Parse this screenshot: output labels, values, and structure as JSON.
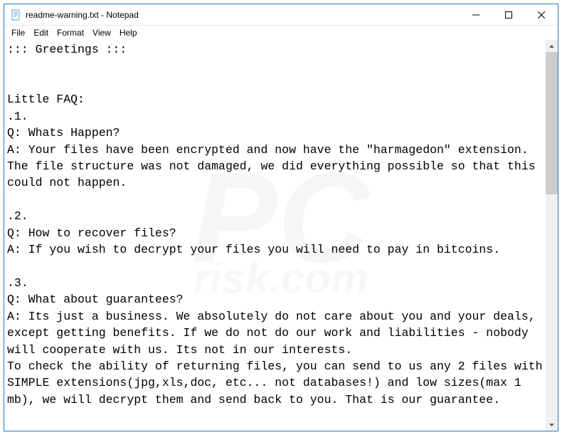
{
  "titlebar": {
    "title": "readme-warning.txt - Notepad"
  },
  "menubar": {
    "file": "File",
    "edit": "Edit",
    "format": "Format",
    "view": "View",
    "help": "Help"
  },
  "content": {
    "text": "::: Greetings :::\n\n\nLittle FAQ:\n.1.\nQ: Whats Happen?\nA: Your files have been encrypted and now have the \"harmagedon\" extension. The file structure was not damaged, we did everything possible so that this could not happen.\n\n.2.\nQ: How to recover files?\nA: If you wish to decrypt your files you will need to pay in bitcoins.\n\n.3.\nQ: What about guarantees?\nA: Its just a business. We absolutely do not care about you and your deals, except getting benefits. If we do not do our work and liabilities - nobody will cooperate with us. Its not in our interests.\nTo check the ability of returning files, you can send to us any 2 files with SIMPLE extensions(jpg,xls,doc, etc... not databases!) and low sizes(max 1 mb), we will decrypt them and send back to you. That is our guarantee."
  },
  "watermark": {
    "main": "PC",
    "sub": "risk.com"
  }
}
